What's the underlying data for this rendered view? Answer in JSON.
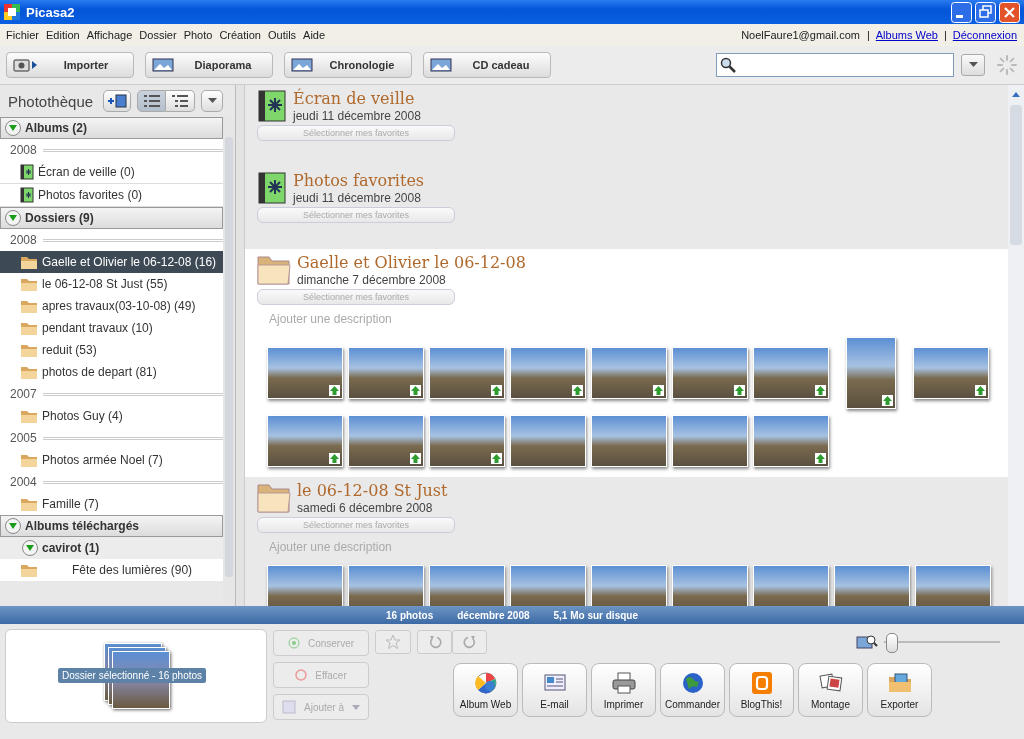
{
  "window": {
    "title": "Picasa2"
  },
  "menu": [
    "Fichier",
    "Edition",
    "Affichage",
    "Dossier",
    "Photo",
    "Création",
    "Outils",
    "Aide"
  ],
  "account": [
    {
      "kind": "text",
      "label": "NoelFaure1@gmail.com"
    },
    {
      "kind": "separator",
      "label": "|"
    },
    {
      "kind": "link",
      "label": "Albums Web"
    },
    {
      "kind": "separator",
      "label": "|"
    },
    {
      "kind": "link",
      "label": "Déconnexion"
    }
  ],
  "toolbar": [
    {
      "label": "Importer",
      "selected": false
    },
    {
      "label": "Diaporama",
      "selected": false
    },
    {
      "label": "Chronologie",
      "selected": false
    },
    {
      "label": "CD cadeau",
      "selected": false
    }
  ],
  "sidebar": {
    "title": "Photothèque",
    "views": [
      {
        "selected": true
      },
      {
        "selected": false
      }
    ],
    "groups": [
      {
        "label": "Albums (2)",
        "expanded": true,
        "children": [
          {
            "kind": "year",
            "label": "2008"
          },
          {
            "kind": "album",
            "label": "Écran de veille (0)",
            "selected": false
          },
          {
            "kind": "album",
            "label": "Photos favorites (0)",
            "selected": false
          }
        ]
      },
      {
        "label": "Dossiers (9)",
        "expanded": true,
        "children": [
          {
            "kind": "year",
            "label": "2008"
          },
          {
            "kind": "folder",
            "label": "Gaelle et Olivier le 06-12-08 (16)",
            "selected": true
          },
          {
            "kind": "folder",
            "label": "le 06-12-08 St Just (55)",
            "selected": false
          },
          {
            "kind": "folder",
            "label": "apres travaux(03-10-08) (49)",
            "selected": false
          },
          {
            "kind": "folder",
            "label": "pendant travaux (10)",
            "selected": false
          },
          {
            "kind": "folder",
            "label": "reduit (53)",
            "selected": false
          },
          {
            "kind": "folder",
            "label": "photos de depart (81)",
            "selected": false
          },
          {
            "kind": "year",
            "label": "2007"
          },
          {
            "kind": "folder",
            "label": "Photos Guy (4)",
            "selected": false
          },
          {
            "kind": "year",
            "label": "2005"
          },
          {
            "kind": "folder",
            "label": "Photos armée Noel (7)",
            "selected": false
          },
          {
            "kind": "year",
            "label": "2004"
          },
          {
            "kind": "folder",
            "label": "Famille (7)",
            "selected": false
          }
        ]
      },
      {
        "label": "Albums téléchargés",
        "expanded": true,
        "children": [
          {
            "kind": "user",
            "label": "cavirot (1)",
            "expanded": true,
            "children": [
              {
                "kind": "folder",
                "label": "Fête des lumières (90)",
                "selected": false
              }
            ]
          }
        ]
      }
    ]
  },
  "sections": [
    {
      "kind": "album",
      "title": "Écran de veille",
      "date": "jeudi 11 décembre 2008",
      "favorites_button": "Sélectionner mes favorites",
      "selected": false
    },
    {
      "kind": "album",
      "title": "Photos favorites",
      "date": "jeudi 11 décembre 2008",
      "favorites_button": "Sélectionner mes favorites",
      "selected": false
    },
    {
      "kind": "folder",
      "title": "Gaelle et Olivier le 06-12-08",
      "date": "dimanche 7 décembre 2008",
      "favorites_button": "Sélectionner mes favorites",
      "description_placeholder": "Ajouter une description",
      "selected": true,
      "photos": [
        {
          "kind": "landscape",
          "upload_mark": true
        },
        {
          "kind": "landscape",
          "upload_mark": true
        },
        {
          "kind": "landscape",
          "upload_mark": true
        },
        {
          "kind": "landscape",
          "upload_mark": true
        },
        {
          "kind": "landscape",
          "upload_mark": true
        },
        {
          "kind": "landscape",
          "upload_mark": true
        },
        {
          "kind": "landscape",
          "upload_mark": true
        },
        {
          "kind": "portrait",
          "upload_mark": true
        },
        {
          "kind": "landscape",
          "upload_mark": true
        },
        {
          "kind": "landscape",
          "upload_mark": true
        },
        {
          "kind": "landscape",
          "upload_mark": true
        },
        {
          "kind": "landscape",
          "upload_mark": true
        },
        {
          "kind": "landscape",
          "upload_mark": false
        },
        {
          "kind": "landscape",
          "upload_mark": false
        },
        {
          "kind": "landscape",
          "upload_mark": false
        },
        {
          "kind": "landscape",
          "upload_mark": true
        }
      ]
    },
    {
      "kind": "folder",
      "title": "le 06-12-08 St Just",
      "date": "samedi 6 décembre 2008",
      "favorites_button": "Sélectionner mes favorites",
      "description_placeholder": "Ajouter une description",
      "selected": false,
      "photos": [
        {
          "kind": "landscape",
          "upload_mark": false
        },
        {
          "kind": "landscape",
          "upload_mark": false
        },
        {
          "kind": "landscape",
          "upload_mark": false
        },
        {
          "kind": "landscape",
          "upload_mark": false
        },
        {
          "kind": "landscape",
          "upload_mark": false
        },
        {
          "kind": "landscape",
          "upload_mark": false
        },
        {
          "kind": "landscape",
          "upload_mark": false
        },
        {
          "kind": "landscape",
          "upload_mark": false
        },
        {
          "kind": "landscape",
          "upload_mark": false
        }
      ]
    }
  ],
  "status_bar": [
    "16 photos",
    "décembre 2008",
    "5,1 Mo sur disque"
  ],
  "tray": {
    "selection_label": "Dossier sélectionné - 16 photos",
    "side_buttons": [
      {
        "kind": "keep",
        "label": "Conserver",
        "disabled": true
      },
      {
        "kind": "delete",
        "label": "Effacer",
        "disabled": true
      },
      {
        "kind": "add",
        "label": "Ajouter à",
        "disabled": true
      }
    ],
    "zoom": {
      "level": 0.02
    },
    "actions": [
      "Album Web",
      "E-mail",
      "Imprimer",
      "Commander",
      "BlogThis!",
      "Montage",
      "Exporter"
    ]
  }
}
